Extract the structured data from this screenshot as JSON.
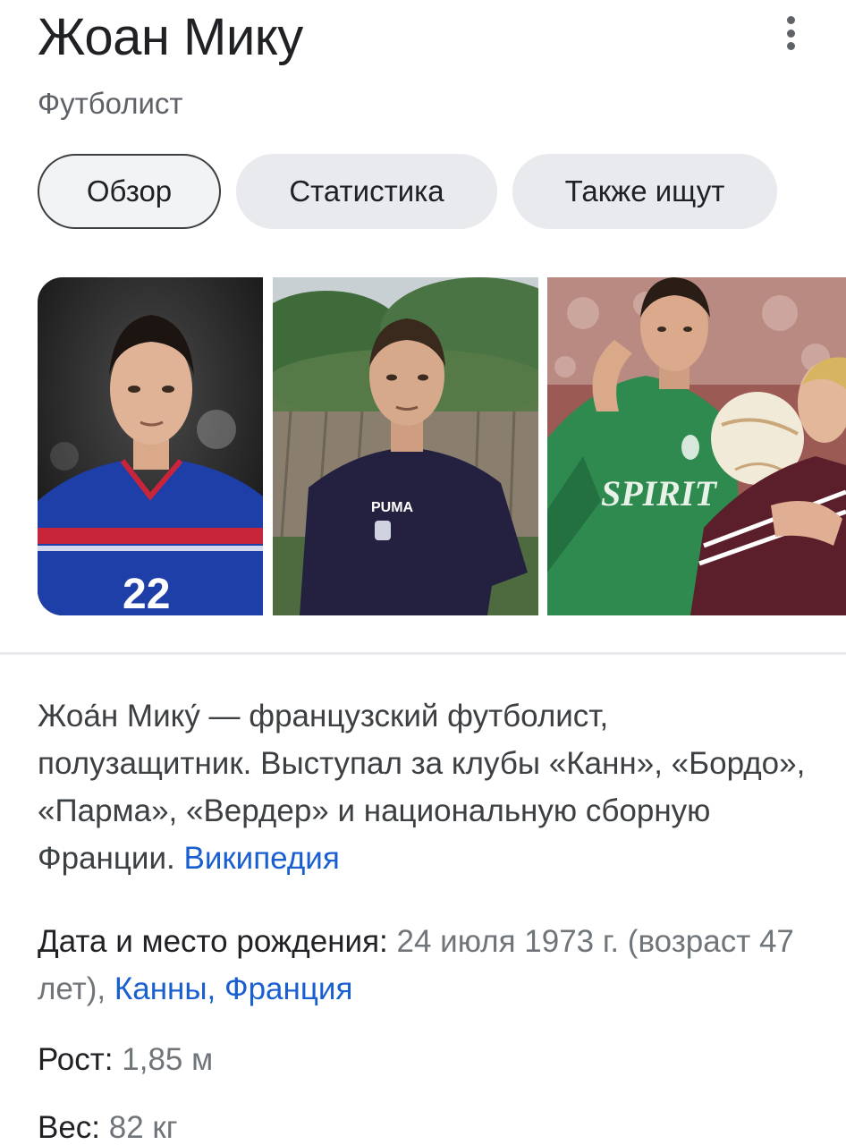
{
  "header": {
    "title": "Жоан Мику",
    "subtitle": "Футболист",
    "menu_icon": "more-vert-icon"
  },
  "tabs": [
    {
      "label": "Обзор",
      "active": true
    },
    {
      "label": "Статистика",
      "active": false
    },
    {
      "label": "Также ищут",
      "active": false
    }
  ],
  "gallery": {
    "images": [
      {
        "depicts": "player-france-jersey-photo"
      },
      {
        "depicts": "player-bordeaux-shirt-photo"
      },
      {
        "depicts": "player-werder-match-photo"
      }
    ]
  },
  "description": {
    "text": "Жоа́н Мику́ — французский футболист, полузащитник. Выступал за клубы «Канн», «Бордо», «Парма», «Вердер» и национальную сборную Франции. ",
    "source_link": "Википедия"
  },
  "facts": {
    "birth": {
      "label": "Дата и место рождения: ",
      "value": "24 июля 1973 г. (возраст 47 лет), ",
      "place_link": "Канны, Франция"
    },
    "height": {
      "label": "Рост: ",
      "value": "1,85 м"
    },
    "weight": {
      "label": "Вес: ",
      "value": "82 кг"
    }
  },
  "colors": {
    "link": "#1a5fd0",
    "secondary_text": "#70757a",
    "chip_bg": "#e8eaed"
  }
}
